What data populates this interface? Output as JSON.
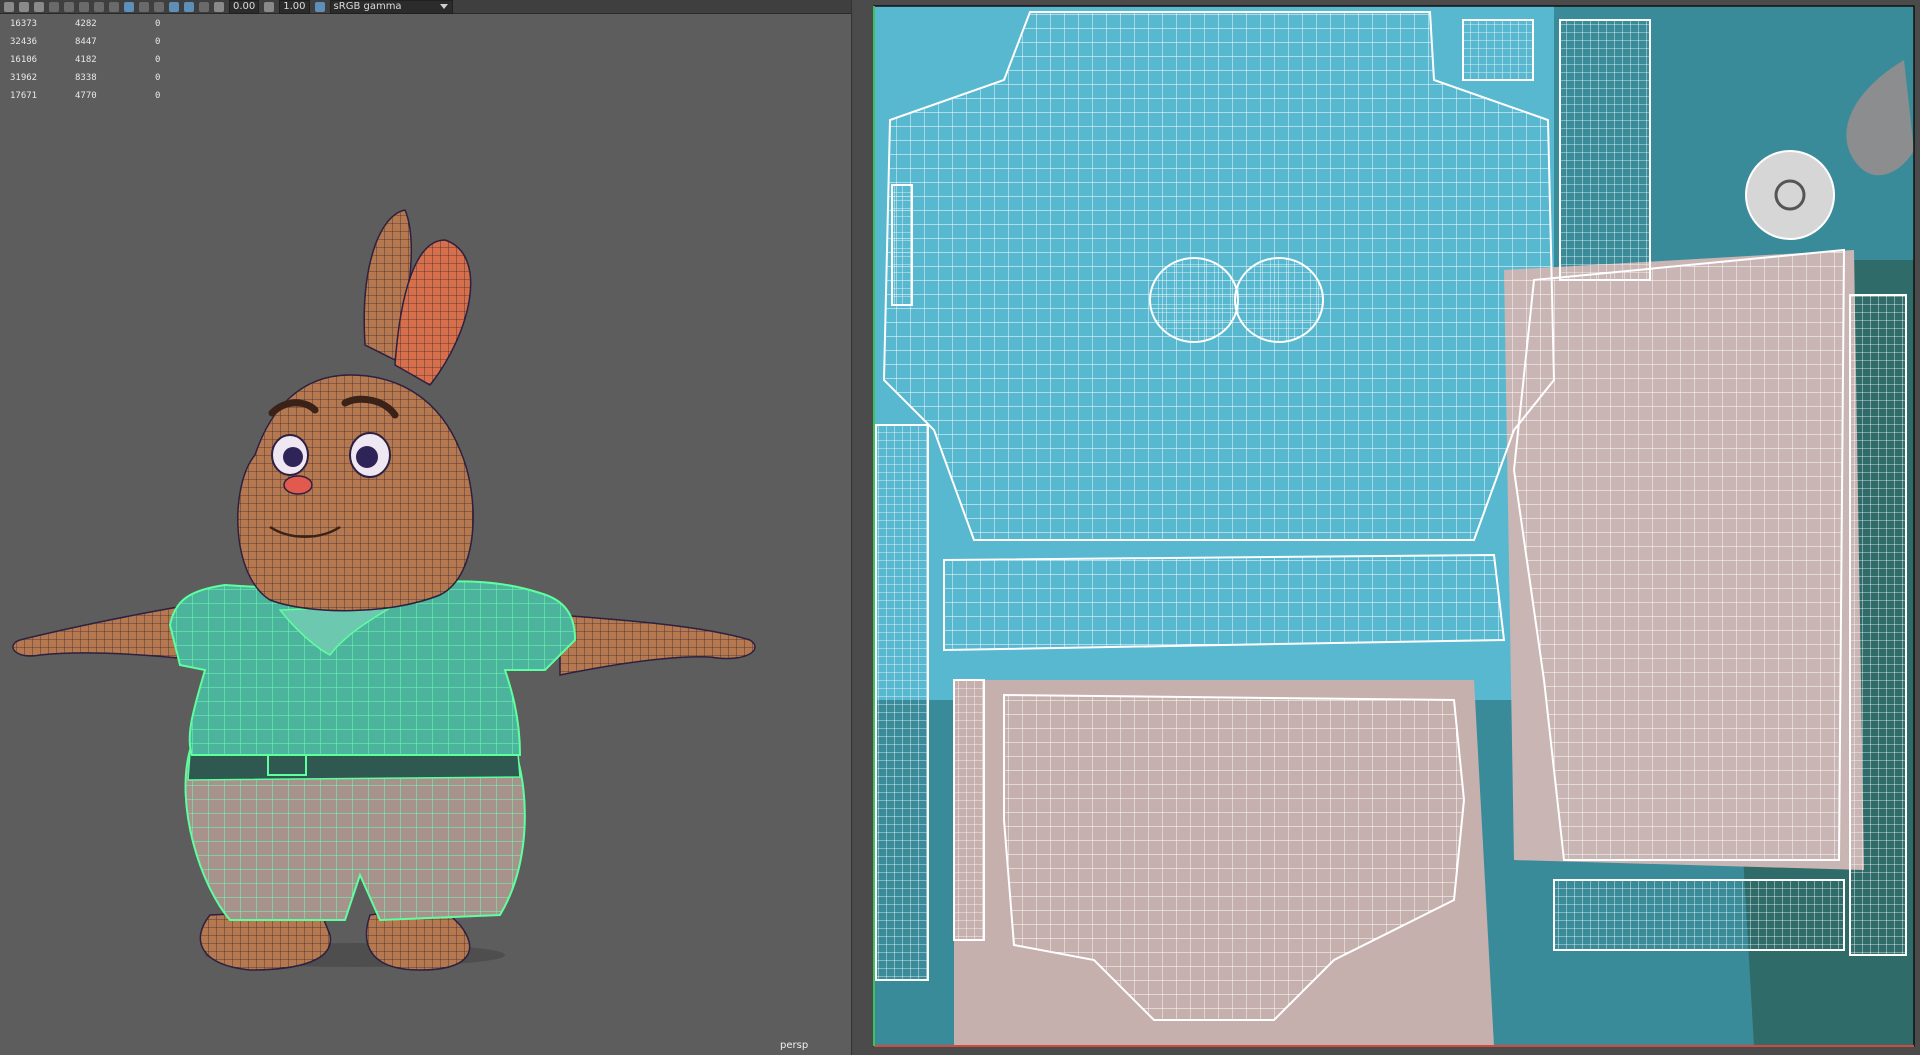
{
  "toolbar": {
    "field1": "0.00",
    "field2": "1.00",
    "colorspace": "sRGB gamma",
    "icons": [
      "select-tool-icon",
      "lasso-tool-icon",
      "paint-tool-icon",
      "grid-icon",
      "film-gate-icon",
      "camera-icon",
      "wireframe-icon",
      "shaded-icon",
      "texture-icon",
      "lighting-icon",
      "shadow-icon",
      "isolate-icon",
      "xray-icon",
      "resolution-gate-icon",
      "exposure-icon",
      "gamma-icon",
      "colorspace-icon"
    ]
  },
  "hud": {
    "rows": [
      [
        "16373",
        "4282",
        "0"
      ],
      [
        "32436",
        "8447",
        "0"
      ],
      [
        "16106",
        "4182",
        "0"
      ],
      [
        "31962",
        "8338",
        "0"
      ],
      [
        "17671",
        "4770",
        "0"
      ]
    ]
  },
  "viewport": {
    "camera": "persp"
  },
  "colors": {
    "viewport_bg": "#5d5d5d",
    "skin": "#b77a52",
    "shirt": "#4fb8a0",
    "uv_shirt": "#55b6cc",
    "uv_pants": "#c8b4b2",
    "uv_teal": "#2d6a68",
    "uv_lines": "#ffffff",
    "selection": "#5dff9e"
  }
}
